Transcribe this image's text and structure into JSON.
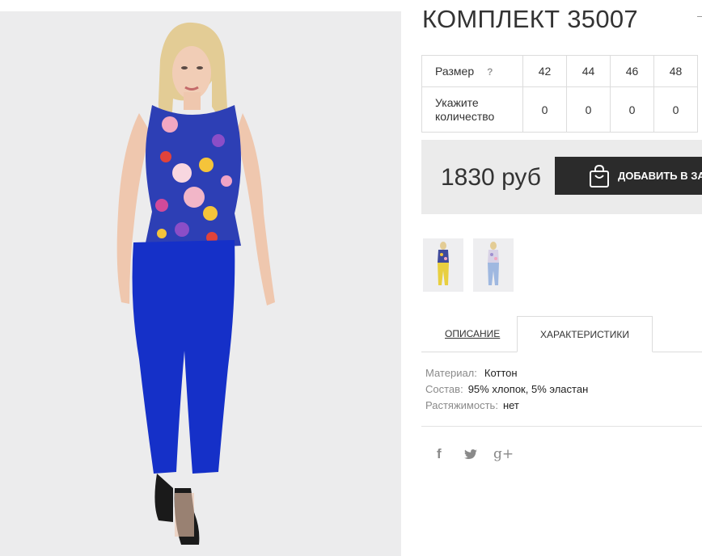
{
  "product": {
    "title": "КОМПЛЕКТ 35007",
    "price": "1830 руб",
    "add_to_cart": "ДОБАВИТЬ В ЗАКАЗ"
  },
  "size_table": {
    "size_label": "Размер",
    "help_mark": "?",
    "qty_label": "Укажите количество",
    "sizes": [
      "42",
      "44",
      "46",
      "48"
    ],
    "quantities": [
      "0",
      "0",
      "0",
      "0"
    ]
  },
  "tabs": {
    "description": "ОПИСАНИЕ",
    "characteristics": "ХАРАКТЕРИСТИКИ",
    "active": "characteristics"
  },
  "specs": [
    {
      "key": "Материал:",
      "value": "Коттон"
    },
    {
      "key": "Состав:",
      "value": "95% хлопок, 5% эластан"
    },
    {
      "key": "Растяжимость:",
      "value": "нет"
    }
  ],
  "social": {
    "facebook": "f",
    "googleplus": "g+"
  },
  "thumbnails": [
    {
      "label": "yellow-pants-look",
      "pants_color": "#e8cf40"
    },
    {
      "label": "light-blue-pants-look",
      "pants_color": "#9fb8e0"
    }
  ],
  "colors": {
    "button_bg": "#2b2b2b",
    "price_box_bg": "#ebebeb",
    "pants": "#1530c8",
    "top": "#2d3fb5"
  }
}
